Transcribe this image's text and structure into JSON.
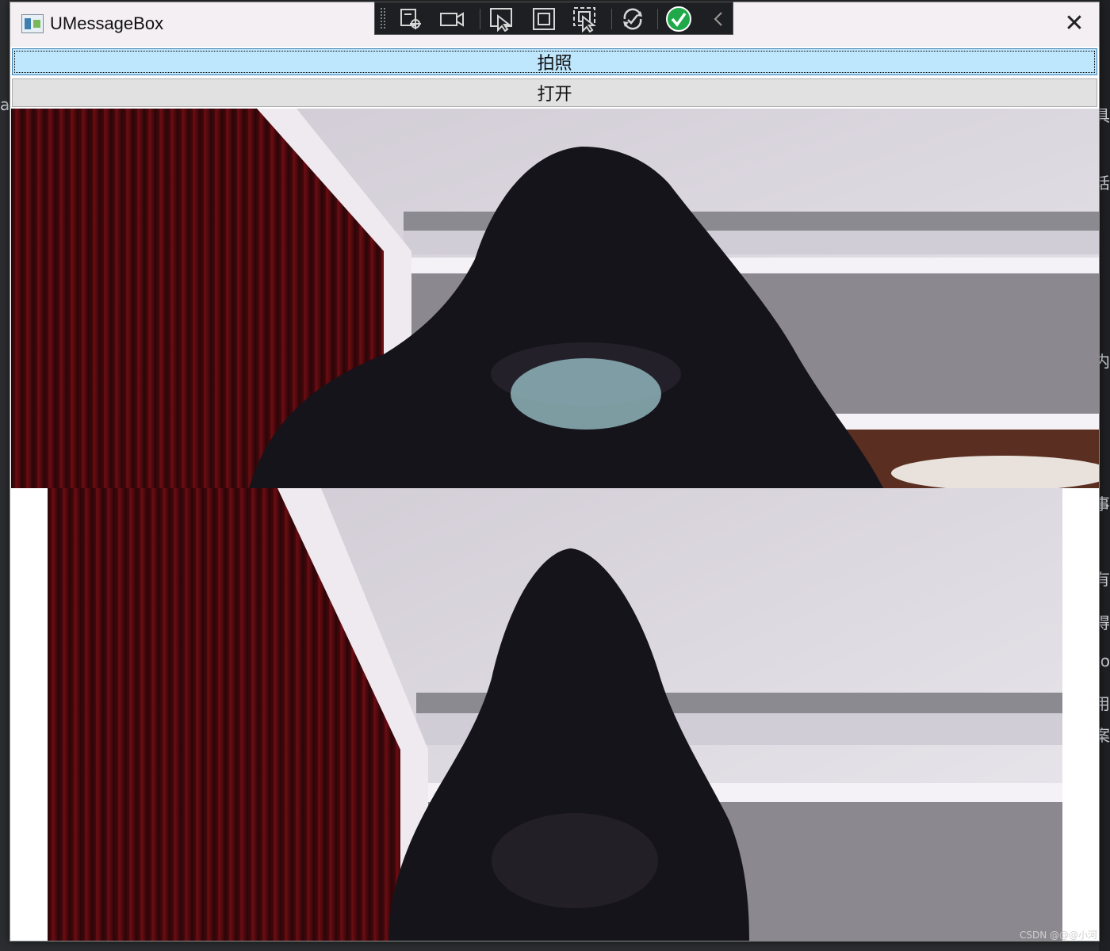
{
  "window": {
    "title": "UMessageBox",
    "close_glyph": "✕"
  },
  "debug_toolbar": {
    "icons": [
      "inspect-element-icon",
      "record-video-icon",
      "select-element-icon",
      "display-layout-adorners-icon",
      "track-focused-element-icon",
      "hot-reload-icon",
      "check-icon",
      "collapse-icon"
    ],
    "check_color": "#1fa94b"
  },
  "buttons": {
    "photo_label": "拍照",
    "open_label": "打开"
  },
  "camera": {
    "top_view": "live-camera-preview",
    "bottom_view": "captured-photo"
  },
  "watermark": "CSDN @@@小河",
  "background_fragments": [
    "ar",
    "具",
    "话",
    "内",
    "事",
    "有",
    "得",
    "to",
    "用",
    "案"
  ],
  "colors": {
    "accent": "#bee6fd",
    "curtain": "#5a0a0e",
    "hood": "#16141b",
    "wall": "#d9d6de"
  }
}
